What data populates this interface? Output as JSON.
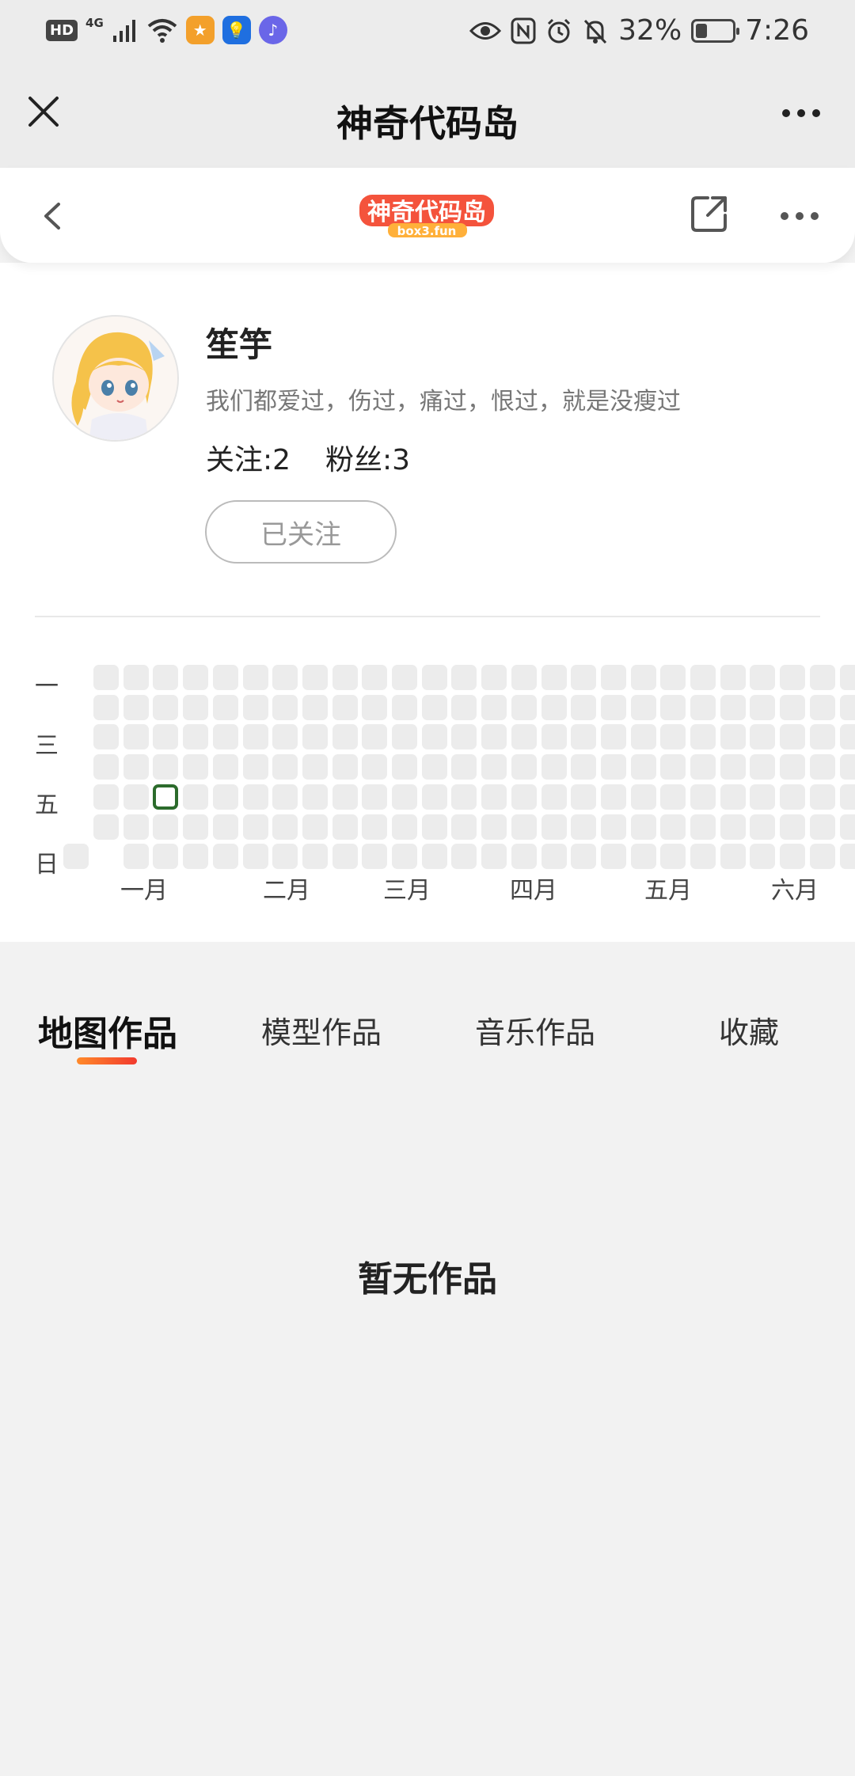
{
  "status_bar": {
    "hd": "HD",
    "network": "4G",
    "battery": "32%",
    "battery_level": 0.32,
    "time": "7:26"
  },
  "title_bar": {
    "title": "神奇代码岛"
  },
  "web_header": {
    "logo_text": "神奇代码岛",
    "logo_sub": "box3.fun"
  },
  "profile": {
    "username": "笙竽",
    "bio": "我们都爱过，伤过，痛过，恨过，就是没瘦过",
    "following": "关注:2",
    "followers": "粉丝:3",
    "follow_button": "已关注"
  },
  "heatmap": {
    "row_labels": [
      "一",
      "三",
      "五",
      "日"
    ],
    "months": [
      "一月",
      "二月",
      "三月",
      "四月",
      "五月",
      "六月"
    ],
    "colors": {
      "empty": "#ececec",
      "active_border": "#2c6b2c"
    }
  },
  "tabs": [
    {
      "label": "地图作品",
      "active": true
    },
    {
      "label": "模型作品",
      "active": false
    },
    {
      "label": "音乐作品",
      "active": false
    },
    {
      "label": "收藏",
      "active": false
    }
  ],
  "empty_state": "暂无作品",
  "colors": {
    "tab_indicator_start": "#ff8a2a",
    "tab_indicator_end": "#f23a2e"
  }
}
